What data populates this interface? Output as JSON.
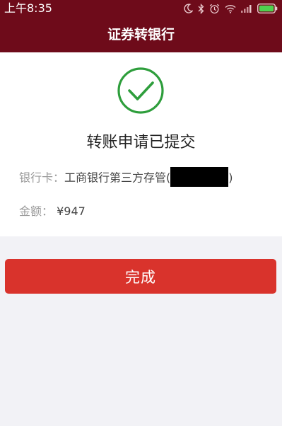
{
  "status_bar": {
    "time": "上午8:35",
    "icons": [
      "moon-icon",
      "bluetooth-icon",
      "alarm-icon",
      "wifi-icon",
      "signal-icon",
      "battery-icon"
    ]
  },
  "header": {
    "title": "证券转银行"
  },
  "result": {
    "icon": "check-circle-icon",
    "title": "转账申请已提交",
    "bank_label": "银行卡：",
    "bank_value_prefix": "工商银行第三方存管(",
    "bank_value_suffix": ")",
    "amount_label": "金额：",
    "amount_value": "¥947"
  },
  "actions": {
    "done_label": "完成"
  },
  "colors": {
    "header_bg": "#6e0b1a",
    "success_green": "#2e9e3c",
    "button_red": "#d9332c",
    "page_bg": "#f2f2f6"
  }
}
